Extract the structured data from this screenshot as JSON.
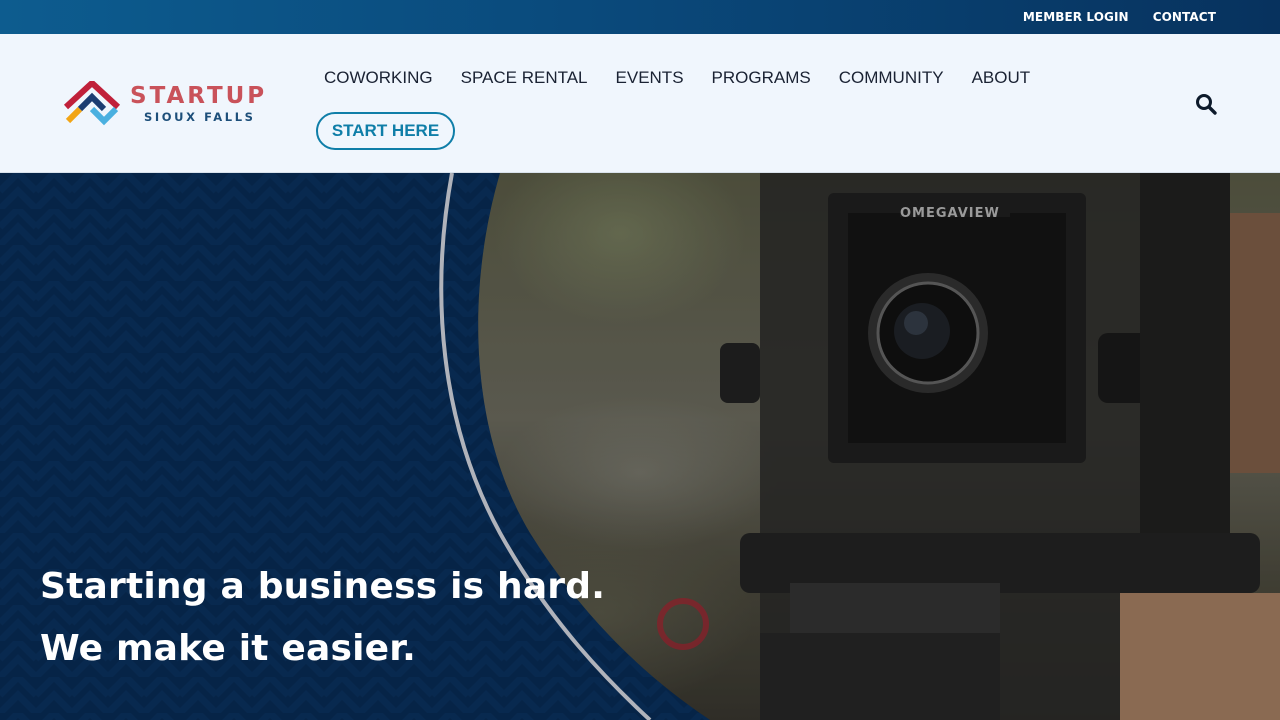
{
  "topbar": {
    "links": [
      "MEMBER LOGIN",
      "CONTACT"
    ]
  },
  "logo": {
    "word": "STARTUP",
    "sub": "SIOUX FALLS"
  },
  "nav": {
    "items": [
      "COWORKING",
      "SPACE RENTAL",
      "EVENTS",
      "PROGRAMS",
      "COMMUNITY",
      "ABOUT"
    ],
    "cta_label": "START HERE"
  },
  "icons": {
    "search": "search-icon",
    "logo_mark": "logo-mark-icon"
  },
  "hero": {
    "line1": "Starting a business is hard.",
    "line2": "We make it easier.",
    "camera_brand": "OMEGAVIEW"
  },
  "colors": {
    "topbar": "#07325e",
    "header_bg": "#f0f6fd",
    "accent": "#0f7ea8",
    "logo_red": "#c9525a",
    "logo_navy": "#1d4f7a",
    "hero_navy": "#062447",
    "ring": "#b0b3bb"
  }
}
